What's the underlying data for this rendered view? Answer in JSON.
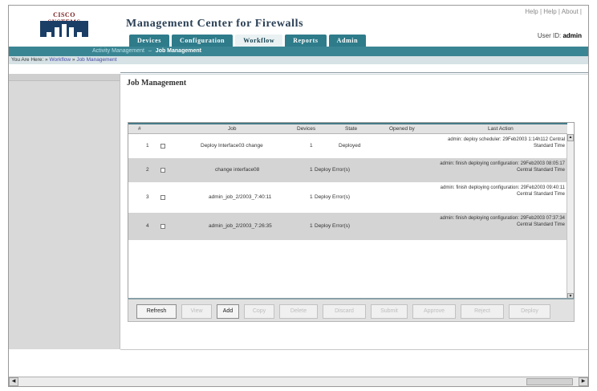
{
  "header": {
    "logo_text": "CISCO SYSTEMS",
    "app_title": "Management Center for Firewalls",
    "util_links": "Help | Help | About |",
    "user_id_label": "User ID:",
    "user_id_value": "admin"
  },
  "tabs": [
    {
      "label": "Devices",
      "active": false
    },
    {
      "label": "Configuration",
      "active": false
    },
    {
      "label": "Workflow",
      "active": true
    },
    {
      "label": "Reports",
      "active": false
    },
    {
      "label": "Admin",
      "active": false
    }
  ],
  "subnav": {
    "items": [
      "Activity Management",
      "Job Management"
    ],
    "current_index": 1
  },
  "breadcrumb": {
    "prefix": "You Are Here:",
    "links": [
      "Workflow",
      "Job Management"
    ]
  },
  "page_title": "Job Management",
  "table": {
    "columns": [
      "#",
      "Job",
      "Devices",
      "State",
      "Opened by",
      "Last Action"
    ],
    "rows": [
      {
        "num": "1",
        "job": "Deploy Interface03 change",
        "devices": "1",
        "state": "Deployed",
        "opened_by": "",
        "last_action": "admin: deploy scheduler: 29Feb2003 1:14h112 Central Standard Time"
      },
      {
        "num": "2",
        "job": "change interface08",
        "devices": "1",
        "state": "Deploy Error(s)",
        "opened_by": "",
        "last_action": "admin: finish deploying configuration: 29Feb2003 08:05:17 Central Standard Time"
      },
      {
        "num": "3",
        "job": "admin_job_2/2003_7:40:11",
        "devices": "1",
        "state": "Deploy Error(s)",
        "opened_by": "",
        "last_action": "admin: finish deploying configuration: 29Feb2003 09:40:11 Central Standard Time"
      },
      {
        "num": "4",
        "job": "admin_job_2/2003_7:26:35",
        "devices": "1",
        "state": "Deploy Error(s)",
        "opened_by": "",
        "last_action": "admin: finish deploying configuration: 29Feb2003 07:37:34 Central Standard Time"
      }
    ]
  },
  "buttons": [
    {
      "label": "Refresh",
      "enabled": true
    },
    {
      "label": "View",
      "enabled": false
    },
    {
      "label": "Add",
      "enabled": true
    },
    {
      "label": "Copy",
      "enabled": false
    },
    {
      "label": "Delete",
      "enabled": false
    },
    {
      "label": "Discard",
      "enabled": false
    },
    {
      "label": "Submit",
      "enabled": false
    },
    {
      "label": "Approve",
      "enabled": false
    },
    {
      "label": "Reject",
      "enabled": false
    },
    {
      "label": "Deploy",
      "enabled": false
    }
  ],
  "colors": {
    "tab_bg": "#2e7b8a",
    "subbar_bg": "#3a8593",
    "logo_bg": "#1a3e66"
  }
}
